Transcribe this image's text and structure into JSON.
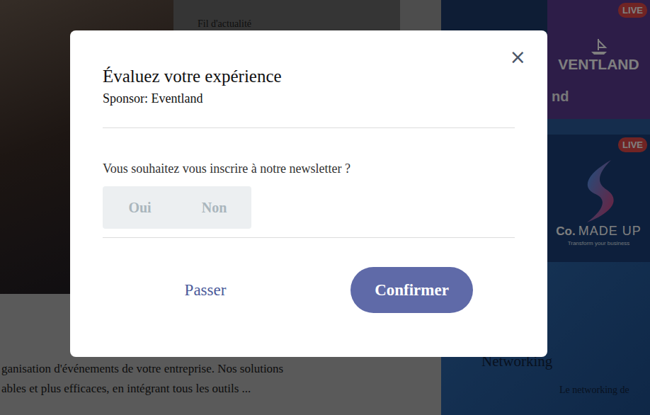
{
  "background": {
    "feed_title": "Fil d'actualité",
    "description_lines": [
      "ganisation d'événements de votre entreprise. Nos solutions",
      "ables et plus efficaces, en intégrant tous les outils ..."
    ],
    "tiles": [
      {
        "badge": "LIVE",
        "logo": "VENTLAND",
        "caption": "nd"
      },
      {
        "badge": "LIVE",
        "logo": "MADE UP",
        "logo_suffix": "Co.",
        "tagline": "Transform your business"
      }
    ],
    "networking": {
      "title": "Networking",
      "text": "Le networking de"
    }
  },
  "modal": {
    "title": "Évaluez votre expérience",
    "subtitle": "Sponsor: Eventland",
    "close": "×",
    "question": "Vous souhaitez vous inscrire à notre newsletter ?",
    "options": [
      {
        "label": "Oui",
        "selected": false
      },
      {
        "label": "Non",
        "selected": false
      }
    ],
    "buttons": [
      {
        "label": "Passer",
        "kind": "text"
      },
      {
        "label": "Confirmer",
        "kind": "primary"
      }
    ]
  }
}
